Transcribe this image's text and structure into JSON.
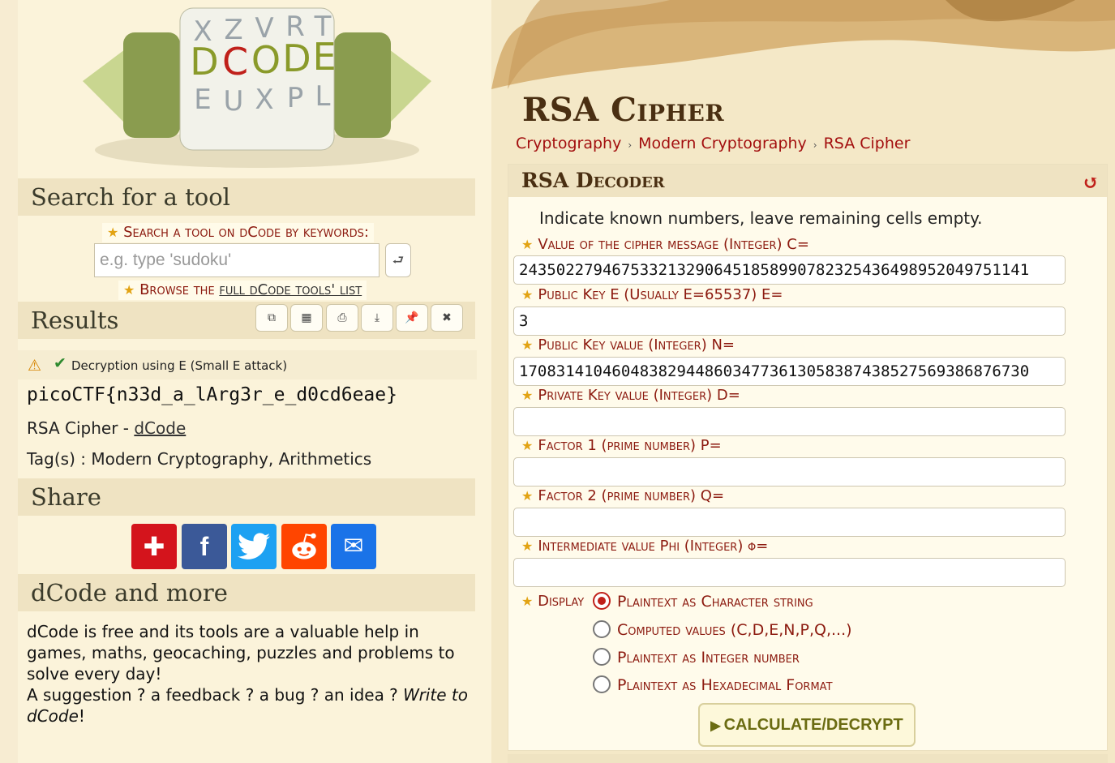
{
  "left": {
    "logo": {
      "wheel_letters": [
        "X",
        "Z",
        "V",
        "R",
        "T",
        "D",
        "C",
        "O",
        "D",
        "E",
        "E",
        "U",
        "X",
        "P",
        "L"
      ]
    },
    "search_section": {
      "title": "Search for a tool",
      "label": "Search a tool on dCode by keywords:",
      "placeholder": "e.g. type 'sudoku'",
      "go_icon": "search-go-icon",
      "browse_prefix": "Browse the ",
      "browse_link": "full dCode tools' list"
    },
    "results_section": {
      "title": "Results",
      "toolbar_icons": [
        "copy-icon",
        "save-icon",
        "print-icon",
        "download-icon",
        "pin-icon",
        "close-icon"
      ],
      "note": "Decryption using E (Small E attack)",
      "flag": "picoCTF{n33d_a_lArg3r_e_d0cd6eae}",
      "rsa_text": "RSA Cipher - ",
      "rsa_link": "dCode",
      "tags": "Tag(s) : Modern Cryptography, Arithmetics"
    },
    "share_section": {
      "title": "Share",
      "buttons": [
        {
          "name": "share-add-button",
          "glyph": "+",
          "color": "#d4141c"
        },
        {
          "name": "facebook-button",
          "glyph": "f",
          "color": "#3b5998"
        },
        {
          "name": "twitter-button",
          "glyph": "t",
          "color": "#1da1f2"
        },
        {
          "name": "reddit-button",
          "glyph": "r",
          "color": "#ff4500"
        },
        {
          "name": "email-button",
          "glyph": "✉",
          "color": "#1a73e8"
        }
      ]
    },
    "more_section": {
      "title": "dCode and more",
      "text1": "dCode is free and its tools are a valuable help in games, maths, geocaching, puzzles and problems to solve every day!",
      "text2": "A suggestion ? a feedback ? a bug ? an idea ? ",
      "link": "Write to dCode",
      "text3": "!"
    }
  },
  "right": {
    "title": "RSA Cipher",
    "breadcrumb": [
      "Cryptography",
      "Modern Cryptography",
      "RSA Cipher"
    ],
    "tool": {
      "title": "RSA Decoder",
      "reset_icon": "reset-icon",
      "intro": "Indicate known numbers, leave remaining cells empty.",
      "fields": [
        {
          "label": "Value of the cipher message (Integer) C=",
          "value": "2435022794675332132906451858990782325436498952049751141"
        },
        {
          "label": "Public Key E (Usually E=65537) E=",
          "value": "3"
        },
        {
          "label": "Public Key value (Integer) N=",
          "value": "1708314104604838294486034773613058387438527569386876730"
        },
        {
          "label": "Private Key value (Integer) D=",
          "value": ""
        },
        {
          "label": "Factor 1 (prime number) P=",
          "value": ""
        },
        {
          "label": "Factor 2 (prime number) Q=",
          "value": ""
        },
        {
          "label": "Intermediate value Phi (Integer) φ=",
          "value": ""
        }
      ],
      "display_label": "Display",
      "display_options": [
        {
          "label": "Plaintext as Character string",
          "selected": true
        },
        {
          "label": "Computed values (C,D,E,N,P,Q,...)",
          "selected": false
        },
        {
          "label": "Plaintext as Integer number",
          "selected": false
        },
        {
          "label": "Plaintext as Hexadecimal Format",
          "selected": false
        }
      ],
      "button": "CALCULATE/DECRYPT"
    }
  },
  "colors": {
    "accent_red": "#a30f0f",
    "title_brown": "#4a2f12",
    "panel_bg": "#fffbeb"
  }
}
